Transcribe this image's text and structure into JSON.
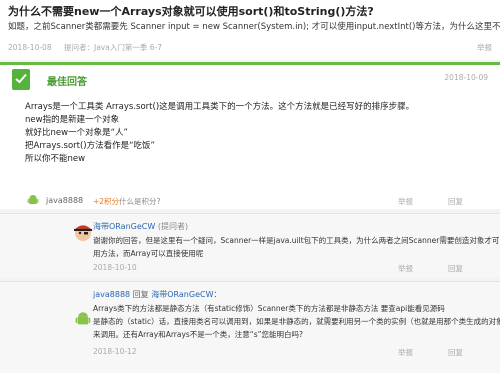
{
  "question": {
    "title": "为什么不需要new一个Arrays对象就可以使用sort()和toString()方法?",
    "body": "如题，之前Scanner类都需要先 Scanner input = new Scanner(System.in); 才可以使用input.nextInt()等方法，为什么这里不需要",
    "date": "2018-10-08",
    "asker": "提问者：Java入门第一季 6-7",
    "report": "举报"
  },
  "best_answer": {
    "badge_label": "最佳回答",
    "date": "2018-10-09",
    "lines": [
      "Arrays是一个工具类 Arrays.sort()这是调用工具类下的一个方法。这个方法就是已经写好的排序步骤。",
      "new指的是新建一个对象",
      "就好比new一个对象是“人”",
      "把Arrays.sort()方法看作是“吃饭”",
      "所以你不能new"
    ],
    "author": "java8888",
    "bonus": "+2积分",
    "bonus_help": "什么是积分?",
    "report": "举报",
    "reply": "回复"
  },
  "comments": [
    {
      "name": "海带ORanGeCW",
      "role": "(提问者)",
      "lines": [
        "谢谢你的回答，但是这里有一个疑问，Scanner一样是java.uilt包下的工具类，为什么两者之间Scanner需要创造对象才可以使",
        "用方法，而Array可以直接使用呢"
      ],
      "date": "2018-10-10",
      "report": "举报",
      "reply": "回复"
    },
    {
      "name": "java8888",
      "reply_word": "回复",
      "reply_to": "海带ORanGeCW：",
      "lines": [
        "Arrays类下的方法都是静态方法（有static修饰）Scanner类下的方法都是非静态方法 要查api能看见源码",
        "是静态的（static）话，直接用类名可以调用到，如果是非静态的，就需要利用另一个类的实例（也就是用那个类生成的对象）",
        "来调用。还有Array和Arrays不是一个类，注意“s”您能明白吗?"
      ],
      "date": "2018-10-12",
      "report": "举报",
      "reply": "回复"
    }
  ],
  "colors": {
    "accent_green": "#55b33c",
    "link_blue": "#2a67b1",
    "bonus_orange": "#e07a1f"
  },
  "icons": [
    "check-badge-icon",
    "android-avatar-icon",
    "pirate-avatar-icon"
  ]
}
